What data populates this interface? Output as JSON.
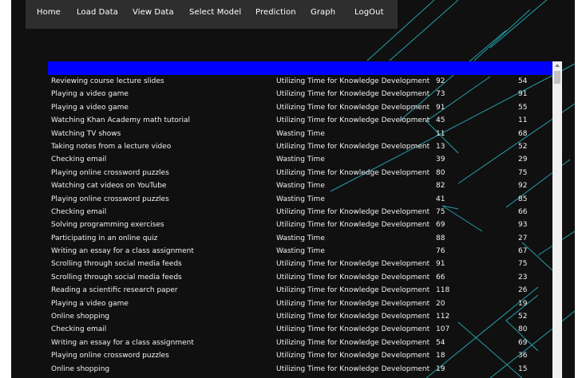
{
  "nav": {
    "items": [
      {
        "label": "Home"
      },
      {
        "label": "Load Data"
      },
      {
        "label": "View Data"
      },
      {
        "label": "Select Model"
      },
      {
        "label": "Prediction"
      },
      {
        "label": "Graph"
      },
      {
        "label": "LogOut"
      }
    ]
  },
  "colors": {
    "page_bg": "#101010",
    "navbar_bg": "#2e2e2e",
    "header_bar": "#0000ff",
    "accent_lines": "#29b8c4",
    "text": "#f2f2f2"
  },
  "table": {
    "rows": [
      {
        "activity": "Reviewing course lecture slides",
        "category": "Utilizing Time for Knowledge Development",
        "v1": "92",
        "v2": "54"
      },
      {
        "activity": "Playing a video game",
        "category": "Utilizing Time for Knowledge Development",
        "v1": "73",
        "v2": "91"
      },
      {
        "activity": "Playing a video game",
        "category": "Utilizing Time for Knowledge Development",
        "v1": "91",
        "v2": "55"
      },
      {
        "activity": "Watching Khan Academy math tutorial",
        "category": "Utilizing Time for Knowledge Development",
        "v1": "45",
        "v2": "11"
      },
      {
        "activity": "Watching TV shows",
        "category": "Wasting Time",
        "v1": "11",
        "v2": "68"
      },
      {
        "activity": "Taking notes from a lecture video",
        "category": "Utilizing Time for Knowledge Development",
        "v1": "13",
        "v2": "52"
      },
      {
        "activity": "Checking email",
        "category": "Wasting Time",
        "v1": "39",
        "v2": "29"
      },
      {
        "activity": "Playing online crossword puzzles",
        "category": "Utilizing Time for Knowledge Development",
        "v1": "80",
        "v2": "75"
      },
      {
        "activity": "Watching cat videos on YouTube",
        "category": "Wasting Time",
        "v1": "82",
        "v2": "92"
      },
      {
        "activity": "Playing online crossword puzzles",
        "category": "Wasting Time",
        "v1": "41",
        "v2": "85"
      },
      {
        "activity": "Checking email",
        "category": "Utilizing Time for Knowledge Development",
        "v1": "75",
        "v2": "66"
      },
      {
        "activity": "Solving programming exercises",
        "category": "Utilizing Time for Knowledge Development",
        "v1": "69",
        "v2": "93"
      },
      {
        "activity": "Participating in an online quiz",
        "category": "Wasting Time",
        "v1": "88",
        "v2": "27"
      },
      {
        "activity": "Writing an essay for a class assignment",
        "category": "Wasting Time",
        "v1": "76",
        "v2": "67"
      },
      {
        "activity": "Scrolling through social media feeds",
        "category": "Utilizing Time for Knowledge Development",
        "v1": "91",
        "v2": "75"
      },
      {
        "activity": "Scrolling through social media feeds",
        "category": "Utilizing Time for Knowledge Development",
        "v1": "66",
        "v2": "23"
      },
      {
        "activity": "Reading a scientific research paper",
        "category": "Utilizing Time for Knowledge Development",
        "v1": "118",
        "v2": "26"
      },
      {
        "activity": "Playing a video game",
        "category": "Utilizing Time for Knowledge Development",
        "v1": "20",
        "v2": "19"
      },
      {
        "activity": "Online shopping",
        "category": "Utilizing Time for Knowledge Development",
        "v1": "112",
        "v2": "52"
      },
      {
        "activity": "Checking email",
        "category": "Utilizing Time for Knowledge Development",
        "v1": "107",
        "v2": "80"
      },
      {
        "activity": "Writing an essay for a class assignment",
        "category": "Utilizing Time for Knowledge Development",
        "v1": "54",
        "v2": "69"
      },
      {
        "activity": "Playing online crossword puzzles",
        "category": "Utilizing Time for Knowledge Development",
        "v1": "18",
        "v2": "36"
      },
      {
        "activity": "Online shopping",
        "category": "Utilizing Time for Knowledge Development",
        "v1": "19",
        "v2": "15"
      }
    ]
  }
}
